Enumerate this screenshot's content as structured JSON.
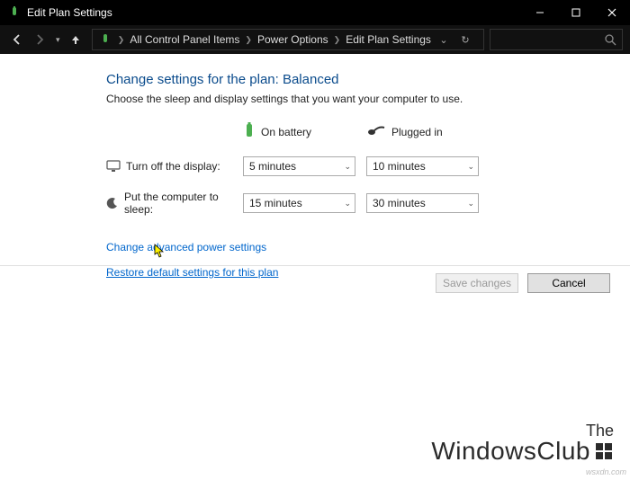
{
  "window": {
    "title": "Edit Plan Settings"
  },
  "breadcrumb": {
    "item1": "All Control Panel Items",
    "item2": "Power Options",
    "item3": "Edit Plan Settings"
  },
  "heading": "Change settings for the plan: Balanced",
  "subheading": "Choose the sleep and display settings that you want your computer to use.",
  "columns": {
    "battery": "On battery",
    "plugged": "Plugged in"
  },
  "rows": {
    "display": {
      "label": "Turn off the display:",
      "battery": "5 minutes",
      "plugged": "10 minutes"
    },
    "sleep": {
      "label": "Put the computer to sleep:",
      "battery": "15 minutes",
      "plugged": "30 minutes"
    }
  },
  "links": {
    "advanced": "Change advanced power settings",
    "restore": "Restore default settings for this plan"
  },
  "buttons": {
    "save": "Save changes",
    "cancel": "Cancel"
  },
  "watermark": {
    "line1": "The",
    "line2": "WindowsClub",
    "url": "wsxdn.com"
  }
}
